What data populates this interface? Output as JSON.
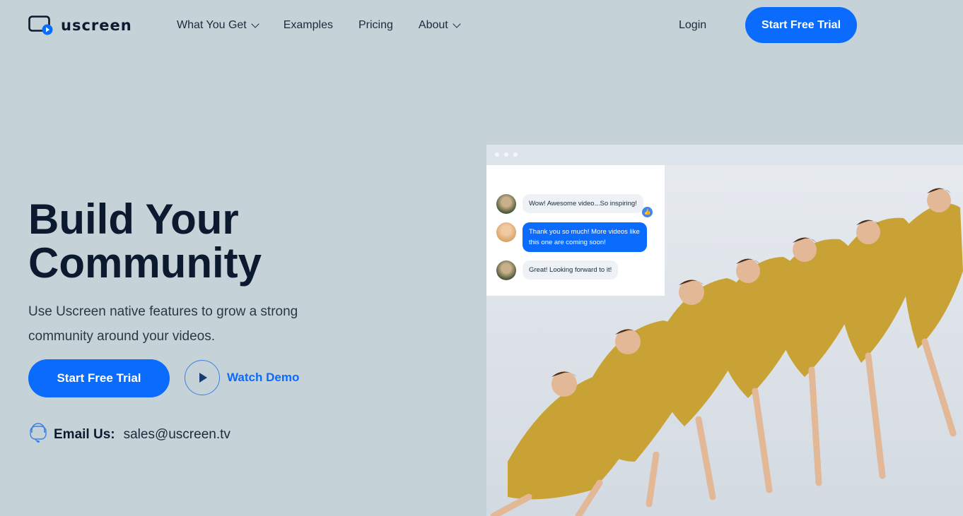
{
  "brand": {
    "name": "uscreen",
    "accent": "#0a6bfd"
  },
  "nav": {
    "items": [
      {
        "label": "What You Get",
        "dropdown": true
      },
      {
        "label": "Examples",
        "dropdown": false
      },
      {
        "label": "Pricing",
        "dropdown": false
      },
      {
        "label": "About",
        "dropdown": true
      }
    ],
    "login": "Login",
    "cta": "Start Free Trial"
  },
  "hero": {
    "title_line1": "Build Your",
    "title_line2": "Community",
    "subtitle": "Use Uscreen native features to grow a strong community around your videos.",
    "cta": "Start Free Trial",
    "watch_demo": "Watch Demo",
    "email_label": "Email Us:",
    "email_address": "sales@uscreen.tv"
  },
  "chat": {
    "messages": [
      {
        "text": "Wow! Awesome video...So inspiring!",
        "style": "grey",
        "liked": true
      },
      {
        "text": "Thank you so much! More videos like this one are coming soon!",
        "style": "blue",
        "liked": false
      },
      {
        "text": "Great! Looking forward to it!",
        "style": "grey",
        "liked": false
      }
    ]
  },
  "icons": {
    "logo": "video-play-logo-icon",
    "support": "headset-icon",
    "play": "play-icon",
    "like": "thumbs-up-icon"
  }
}
